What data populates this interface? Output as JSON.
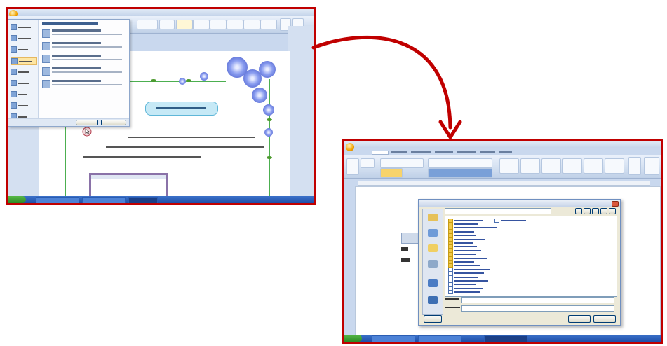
{
  "shot1": {
    "callout_text": "",
    "doc_lines": [],
    "menu": {
      "left_items": [
        "",
        "",
        "",
        "",
        "",
        "",
        "",
        "",
        "",
        ""
      ],
      "right_items": [
        "",
        "",
        "",
        "",
        "",
        ""
      ]
    }
  },
  "shot2": {
    "dialog": {
      "file_rows": 20
    }
  },
  "colors": {
    "frame_border": "#c00000",
    "arrow": "#c00000",
    "taskbar": "#1f4fa8",
    "start_button": "#2c8a24",
    "ribbon": "#cddbee",
    "vine": "#4caf50",
    "flower": "#6f82e0",
    "callout_fill": "#c6e9f6",
    "dialog_face": "#ece9d8"
  },
  "icons": [
    "office-orb-icon",
    "folder-icon",
    "document-icon",
    "recent-places-icon",
    "desktop-icon",
    "my-documents-icon",
    "my-computer-icon",
    "network-icon",
    "flower-decoration-icon",
    "cursor-hand-icon"
  ]
}
